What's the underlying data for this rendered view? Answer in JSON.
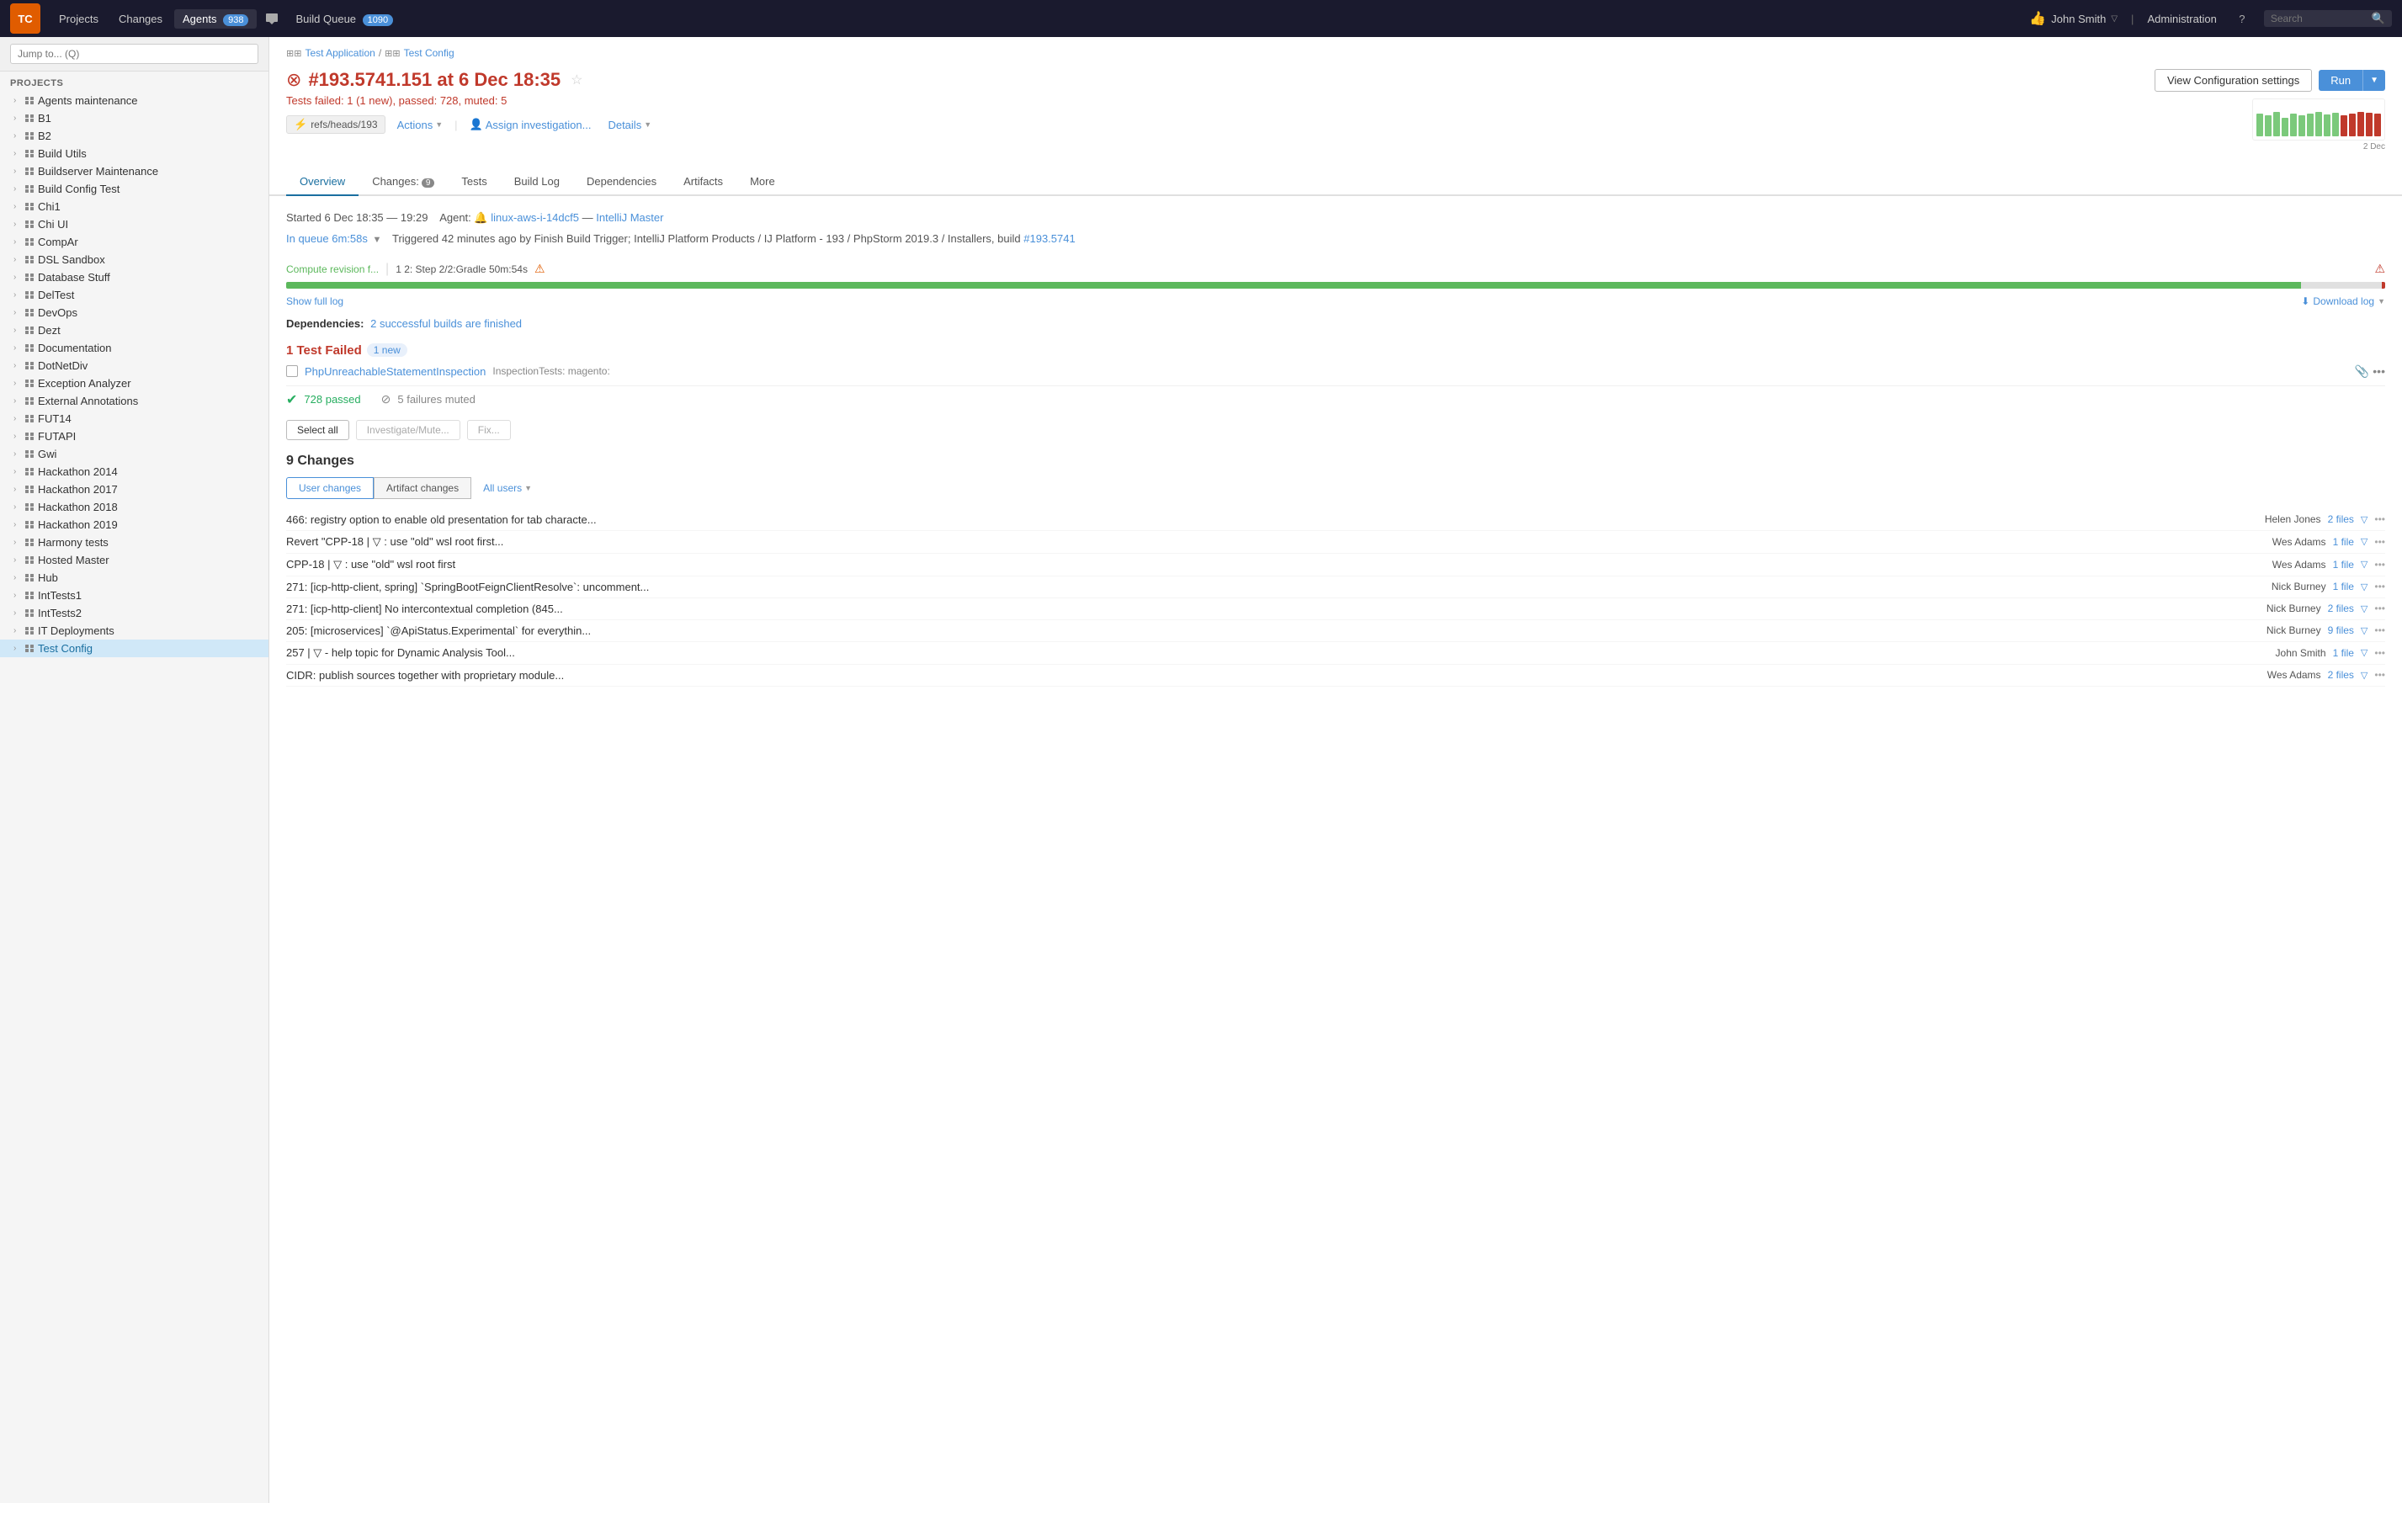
{
  "nav": {
    "logo": "TC",
    "projects_label": "Projects",
    "changes_label": "Changes",
    "agents_label": "Agents",
    "agents_count": "938",
    "build_queue_label": "Build Queue",
    "build_queue_count": "1090",
    "user_name": "John Smith",
    "admin_label": "Administration",
    "search_placeholder": "Search"
  },
  "sidebar": {
    "jump_placeholder": "Jump to... (Q)",
    "projects_label": "PROJECTS",
    "items": [
      {
        "id": "agents-maintenance",
        "label": "Agents maintenance",
        "indent": 1
      },
      {
        "id": "b1",
        "label": "B1",
        "indent": 1
      },
      {
        "id": "b2",
        "label": "B2",
        "indent": 1
      },
      {
        "id": "build-utils",
        "label": "Build Utils",
        "indent": 1
      },
      {
        "id": "buildserver-maintenance",
        "label": "Buildserver Maintenance",
        "indent": 1
      },
      {
        "id": "build-config-test",
        "label": "Build Config Test",
        "indent": 1
      },
      {
        "id": "chi1",
        "label": "Chi1",
        "indent": 1
      },
      {
        "id": "chi-ui",
        "label": "Chi UI",
        "indent": 1
      },
      {
        "id": "compar",
        "label": "CompAr",
        "indent": 1
      },
      {
        "id": "dsl-sandbox",
        "label": "DSL Sandbox",
        "indent": 1
      },
      {
        "id": "database-stuff",
        "label": "Database Stuff",
        "indent": 1
      },
      {
        "id": "deltest",
        "label": "DelTest",
        "indent": 1
      },
      {
        "id": "devops",
        "label": "DevOps",
        "indent": 1
      },
      {
        "id": "dezt",
        "label": "Dezt",
        "indent": 1
      },
      {
        "id": "documentation",
        "label": "Documentation",
        "indent": 1
      },
      {
        "id": "dotnetdiv",
        "label": "DotNetDiv",
        "indent": 1
      },
      {
        "id": "exception-analyzer",
        "label": "Exception Analyzer",
        "indent": 1
      },
      {
        "id": "external-annotations",
        "label": "External Annotations",
        "indent": 1
      },
      {
        "id": "fut14",
        "label": "FUT14",
        "indent": 1
      },
      {
        "id": "futapi",
        "label": "FUTAPI",
        "indent": 1
      },
      {
        "id": "gwi",
        "label": "Gwi",
        "indent": 1
      },
      {
        "id": "hackathon-2014",
        "label": "Hackathon 2014",
        "indent": 1
      },
      {
        "id": "hackathon-2017",
        "label": "Hackathon 2017",
        "indent": 1
      },
      {
        "id": "hackathon-2018",
        "label": "Hackathon 2018",
        "indent": 1
      },
      {
        "id": "hackathon-2019",
        "label": "Hackathon 2019",
        "indent": 1
      },
      {
        "id": "harmony-tests",
        "label": "Harmony tests",
        "indent": 1
      },
      {
        "id": "hosted-master",
        "label": "Hosted Master",
        "indent": 1
      },
      {
        "id": "hub",
        "label": "Hub",
        "indent": 1
      },
      {
        "id": "inttests1",
        "label": "IntTests1",
        "indent": 1
      },
      {
        "id": "inttests2",
        "label": "IntTests2",
        "indent": 1
      },
      {
        "id": "it-deployments",
        "label": "IT Deployments",
        "indent": 1
      },
      {
        "id": "test-config",
        "label": "Test Config",
        "indent": 1,
        "active": true
      }
    ]
  },
  "breadcrumb": {
    "project": "Test Application",
    "separator": "/",
    "config": "Test Config"
  },
  "build": {
    "status_icon": "●",
    "title": "#193.5741.151 at 6 Dec 18:35",
    "star_icon": "☆",
    "subtitle_prefix": "Tests failed: 1 (1 new), passed: 728, muted: ",
    "muted_count": "5",
    "branch": "refs/heads/193",
    "actions_label": "Actions",
    "assign_label": "Assign investigation...",
    "details_label": "Details",
    "view_config_label": "View Configuration settings",
    "run_label": "Run",
    "chart_date": "2 Dec"
  },
  "tabs": [
    {
      "id": "overview",
      "label": "Overview",
      "active": true,
      "badge": null
    },
    {
      "id": "changes",
      "label": "Changes:",
      "badge": "9"
    },
    {
      "id": "tests",
      "label": "Tests"
    },
    {
      "id": "build-log",
      "label": "Build Log"
    },
    {
      "id": "dependencies",
      "label": "Dependencies"
    },
    {
      "id": "artifacts",
      "label": "Artifacts"
    },
    {
      "id": "more",
      "label": "More"
    }
  ],
  "overview": {
    "started_label": "Started",
    "started_time": "6 Dec 18:35",
    "ended_time": "19:29",
    "agent_label": "Agent:",
    "agent_icon": "🔔",
    "agent_name": "linux-aws-i-14dcf5",
    "agent_separator": "—",
    "agent_config": "IntelliJ Master",
    "in_queue": "In queue 6m:58s",
    "triggered": "Triggered 42 minutes ago by Finish Build Trigger; IntelliJ Platform Products / IJ Platform - 193 / PhpStorm 2019.3 / Installers, build",
    "trigger_build": "#193.5741",
    "step1": "Compute revision f...",
    "step2": "1 2: Step 2/2:Gradle 50m:54s",
    "show_full_log": "Show full log",
    "download_log": "Download log",
    "deps_label": "Dependencies:",
    "deps_text": "2 successful builds are finished",
    "test_failed_count": "1 Test Failed",
    "test_failed_new": "1 new",
    "test_name": "PhpUnreachableStatementInspection",
    "test_scope": "InspectionTests: magento:",
    "passed_count": "728 passed",
    "failures_muted": "5 failures muted",
    "select_all": "Select all",
    "investigate_mute": "Investigate/Mute...",
    "fix_label": "Fix...",
    "changes_count": "9 Changes",
    "user_changes_tab": "User changes",
    "artifact_changes_tab": "Artifact changes",
    "all_users_label": "All users"
  },
  "changes": [
    {
      "message": "466: registry option to enable old presentation for tab characte...",
      "author": "Helen Jones",
      "files": "2 files",
      "has_vcs": false
    },
    {
      "message": "Revert \"CPP-18 | ▽ : use \"old\" wsl root first...",
      "author": "Wes Adams",
      "files": "1 file",
      "has_vcs": true
    },
    {
      "message": "CPP-18 | ▽ : use \"old\" wsl root first",
      "author": "Wes Adams",
      "files": "1 file",
      "has_vcs": true
    },
    {
      "message": "271: [icp-http-client, spring] `SpringBootFeignClientResolve`: uncomment...",
      "author": "Nick Burney",
      "files": "1 file",
      "has_vcs": false
    },
    {
      "message": "271: [icp-http-client] No intercontextual completion (845...",
      "author": "Nick Burney",
      "files": "2 files",
      "has_vcs": false
    },
    {
      "message": "205: [microservices] `@ApiStatus.Experimental` for everythin...",
      "author": "Nick Burney",
      "files": "9 files",
      "has_vcs": false
    },
    {
      "message": "257 | ▽ - help topic for Dynamic Analysis Tool...",
      "author": "John Smith",
      "files": "1 file",
      "has_vcs": true
    },
    {
      "message": "CIDR: publish sources together with proprietary module...",
      "author": "Wes Adams",
      "files": "2 files",
      "has_vcs": false
    }
  ],
  "mini_chart": {
    "bars": [
      {
        "height": 60,
        "type": "green"
      },
      {
        "height": 55,
        "type": "green"
      },
      {
        "height": 65,
        "type": "green"
      },
      {
        "height": 50,
        "type": "green"
      },
      {
        "height": 60,
        "type": "green"
      },
      {
        "height": 55,
        "type": "green"
      },
      {
        "height": 60,
        "type": "green"
      },
      {
        "height": 65,
        "type": "green"
      },
      {
        "height": 58,
        "type": "green"
      },
      {
        "height": 62,
        "type": "green"
      },
      {
        "height": 55,
        "type": "fail"
      },
      {
        "height": 60,
        "type": "fail"
      },
      {
        "height": 65,
        "type": "fail"
      },
      {
        "height": 62,
        "type": "fail"
      },
      {
        "height": 60,
        "type": "fail"
      }
    ]
  }
}
